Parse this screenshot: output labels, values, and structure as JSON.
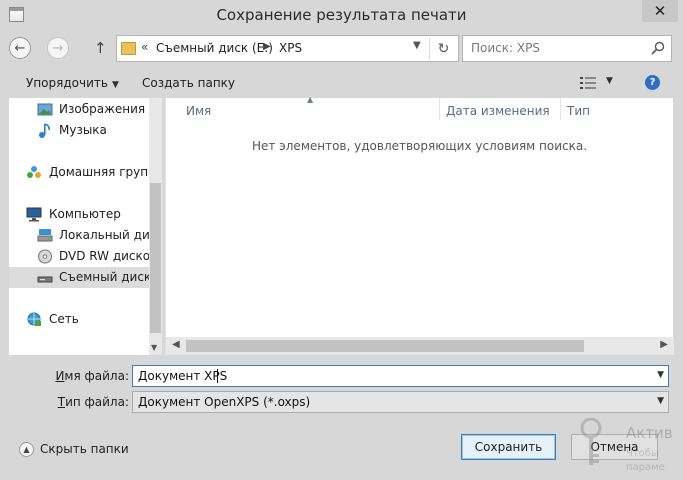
{
  "window": {
    "title": "Сохранение результата печати",
    "close_glyph": "✕"
  },
  "navigation": {
    "address_chevron": "«",
    "address_segments": [
      "Съемный диск (E:)",
      "XPS"
    ],
    "search_placeholder": "Поиск: XPS"
  },
  "toolbar": {
    "organize_label": "Упорядочить",
    "new_folder_label": "Создать папку"
  },
  "sidebar": {
    "items": [
      {
        "label": "Изображения",
        "icon": "pictures-icon"
      },
      {
        "label": "Музыка",
        "icon": "music-icon"
      },
      {
        "label": "Домашняя группа",
        "icon": "homegroup-icon"
      },
      {
        "label": "Компьютер",
        "icon": "computer-icon"
      },
      {
        "label": "Локальный диск",
        "icon": "local-disk-icon"
      },
      {
        "label": "DVD RW дисково",
        "icon": "dvd-drive-icon"
      },
      {
        "label": "Съемный диск (",
        "icon": "removable-disk-icon",
        "selected": true
      },
      {
        "label": "Сеть",
        "icon": "network-icon"
      }
    ]
  },
  "file_list": {
    "columns": [
      "Имя",
      "Дата изменения",
      "Тип"
    ],
    "empty_message": "Нет элементов, удовлетворяющих условиям поиска."
  },
  "form": {
    "filename_label_key": "И",
    "filename_label_rest": "мя файла:",
    "filename_value": "Документ XPS",
    "filetype_label_key": "Т",
    "filetype_label_rest": "ип файла:",
    "filetype_value": "Документ OpenXPS (*.oxps)"
  },
  "footer": {
    "hide_folders_label": "Скрыть папки",
    "save_label": "Сохранить",
    "cancel_label": "Отмена"
  },
  "watermark": {
    "text": "Актив",
    "subtext_line1": "Чтобы",
    "subtext_line2": "параме"
  },
  "colors": {
    "accent_border": "#3c7fb1",
    "help_icon": "#2c6fc4",
    "folder": "#e7c35a"
  }
}
